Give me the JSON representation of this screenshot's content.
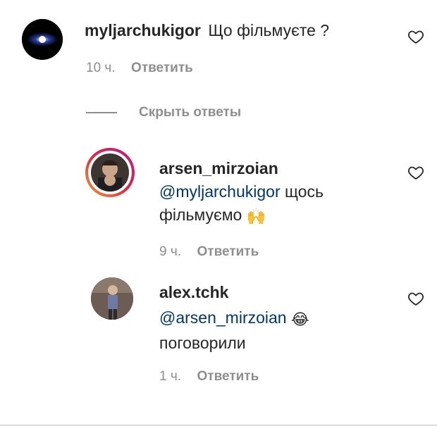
{
  "comment": {
    "username": "myljarchukigor",
    "text": "Що фільмуєте ?",
    "time": "10 ч.",
    "reply_label": "Ответить"
  },
  "thread": {
    "hide_replies_label": "Скрыть ответы"
  },
  "replies": [
    {
      "username": "arsen_mirzoian",
      "mention": "@myljarchukigor",
      "text_part1": " щось",
      "text_part2": "фільмуємо",
      "emoji": "🙌",
      "time": "9 ч.",
      "reply_label": "Ответить"
    },
    {
      "username": "alex.tchk",
      "mention": "@arsen_mirzoian",
      "emoji": "😂",
      "text": "поговорили",
      "time": "1 ч.",
      "reply_label": "Ответить"
    }
  ],
  "icons": {
    "like": "heart-outline-icon"
  },
  "colors": {
    "text": "#262626",
    "muted": "#8e8e8e",
    "mention": "#00376b",
    "divider": "#dbdbdb"
  }
}
